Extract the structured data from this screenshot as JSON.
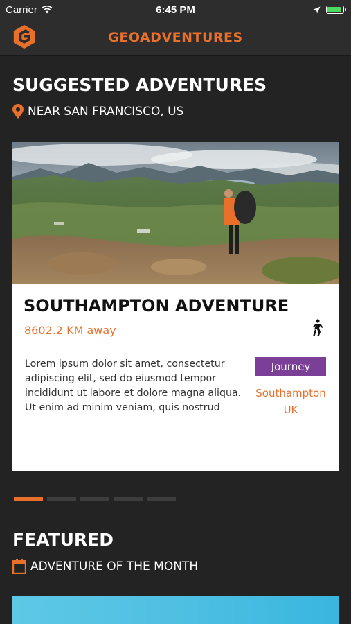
{
  "status_bar": {
    "carrier": "Carrier",
    "time": "6:45 PM",
    "battery_color": "#4cd964",
    "icons": [
      "wifi-icon",
      "location-arrow-icon",
      "battery-icon"
    ]
  },
  "nav": {
    "title": "GEOADVENTURES",
    "logo_icon": "geoadventures-logo-icon",
    "accent_color": "#e8702a"
  },
  "suggested": {
    "title": "SUGGESTED ADVENTURES",
    "location": "NEAR SAN FRANCISCO, US",
    "location_icon": "map-pin-icon"
  },
  "card": {
    "title": "SOUTHAMPTON ADVENTURE",
    "distance": "8602.2 KM away",
    "activity_icon": "hiker-icon",
    "description": "Lorem ipsum dolor sit amet, consectetur adipiscing elit, sed do eiusmod tempor incididunt ut labore et dolore magna aliqua. Ut enim ad minim veniam, quis nostrud",
    "type": "Journey",
    "type_color": "#7b3f98",
    "location_line1": "Southampton",
    "location_line2": "UK"
  },
  "pager": {
    "total": 5,
    "active_index": 0
  },
  "featured": {
    "title": "FEATURED",
    "subtitle": "ADVENTURE OF THE MONTH",
    "subtitle_icon": "calendar-icon"
  }
}
